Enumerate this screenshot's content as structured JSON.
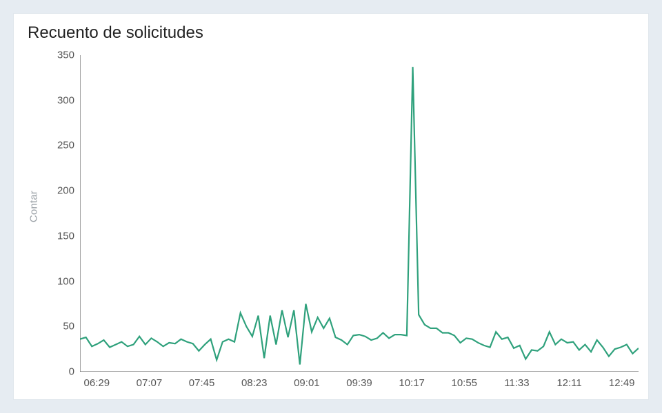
{
  "chart_data": {
    "type": "line",
    "title": "Recuento de solicitudes",
    "ylabel": "Contar",
    "xlabel": "",
    "ylim": [
      0,
      350
    ],
    "y_ticks": [
      0,
      50,
      100,
      150,
      200,
      250,
      300,
      350
    ],
    "x_tick_labels": [
      "06:29",
      "07:07",
      "07:45",
      "08:23",
      "09:01",
      "09:39",
      "10:17",
      "10:55",
      "11:33",
      "12:11",
      "12:49"
    ],
    "series": [
      {
        "name": "requests",
        "color": "#2fa17c",
        "values": [
          36,
          38,
          28,
          31,
          35,
          27,
          30,
          33,
          28,
          30,
          39,
          30,
          37,
          33,
          28,
          32,
          31,
          36,
          33,
          31,
          23,
          30,
          36,
          13,
          33,
          36,
          33,
          65,
          50,
          39,
          62,
          15,
          62,
          30,
          68,
          38,
          68,
          8,
          75,
          44,
          60,
          48,
          59,
          38,
          35,
          30,
          40,
          41,
          39,
          35,
          37,
          43,
          37,
          41,
          41,
          40,
          337,
          63,
          52,
          48,
          48,
          43,
          43,
          40,
          32,
          37,
          36,
          32,
          29,
          27,
          44,
          36,
          38,
          26,
          29,
          14,
          24,
          23,
          28,
          44,
          30,
          36,
          32,
          33,
          24,
          30,
          22,
          35,
          27,
          17,
          25,
          27,
          30,
          20,
          26
        ]
      }
    ]
  }
}
